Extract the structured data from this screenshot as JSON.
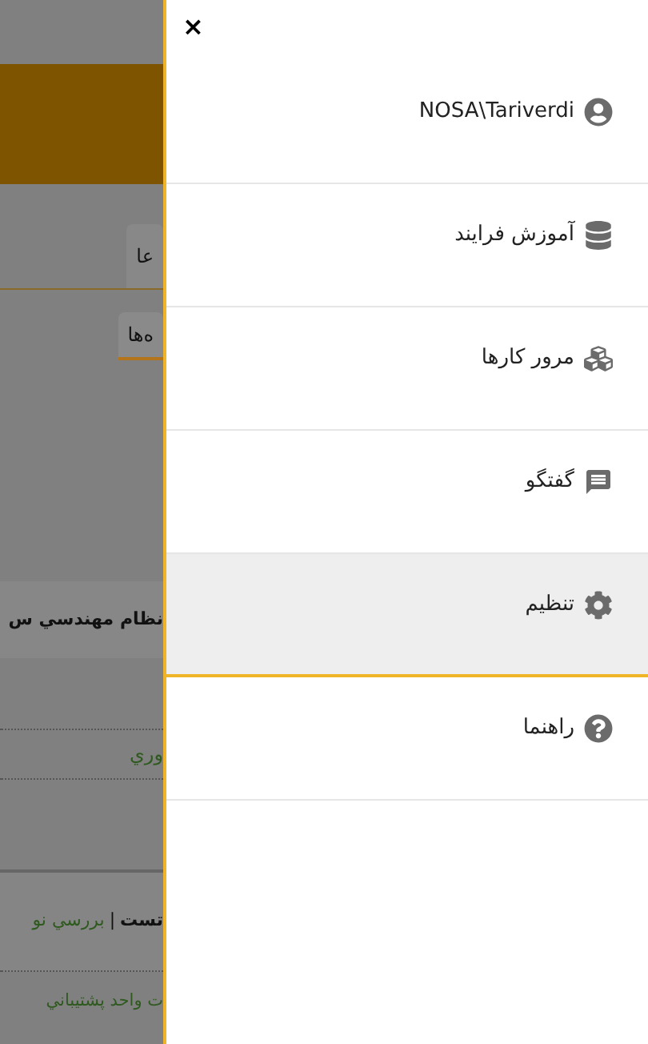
{
  "background": {
    "tabs": [
      {
        "label": "عا",
        "selected": false
      },
      {
        "label": "ه‌ها",
        "selected": true
      }
    ],
    "heading": "نظام مهندسي س",
    "field_value": "وري",
    "task": {
      "title": "تست",
      "separator": "|",
      "subtitle": "بررسي نو"
    },
    "unit": "ت واحد پشتيباني"
  },
  "drawer": {
    "close": "×",
    "items": [
      {
        "label": "NOSA\\Tariverdi",
        "selected": false
      },
      {
        "label": "آموزش فرايند",
        "selected": false
      },
      {
        "label": "مرور کارها",
        "selected": false
      },
      {
        "label": "گفتگو",
        "selected": false
      },
      {
        "label": "تنظيم",
        "selected": true
      },
      {
        "label": "راهنما",
        "selected": false
      }
    ]
  }
}
